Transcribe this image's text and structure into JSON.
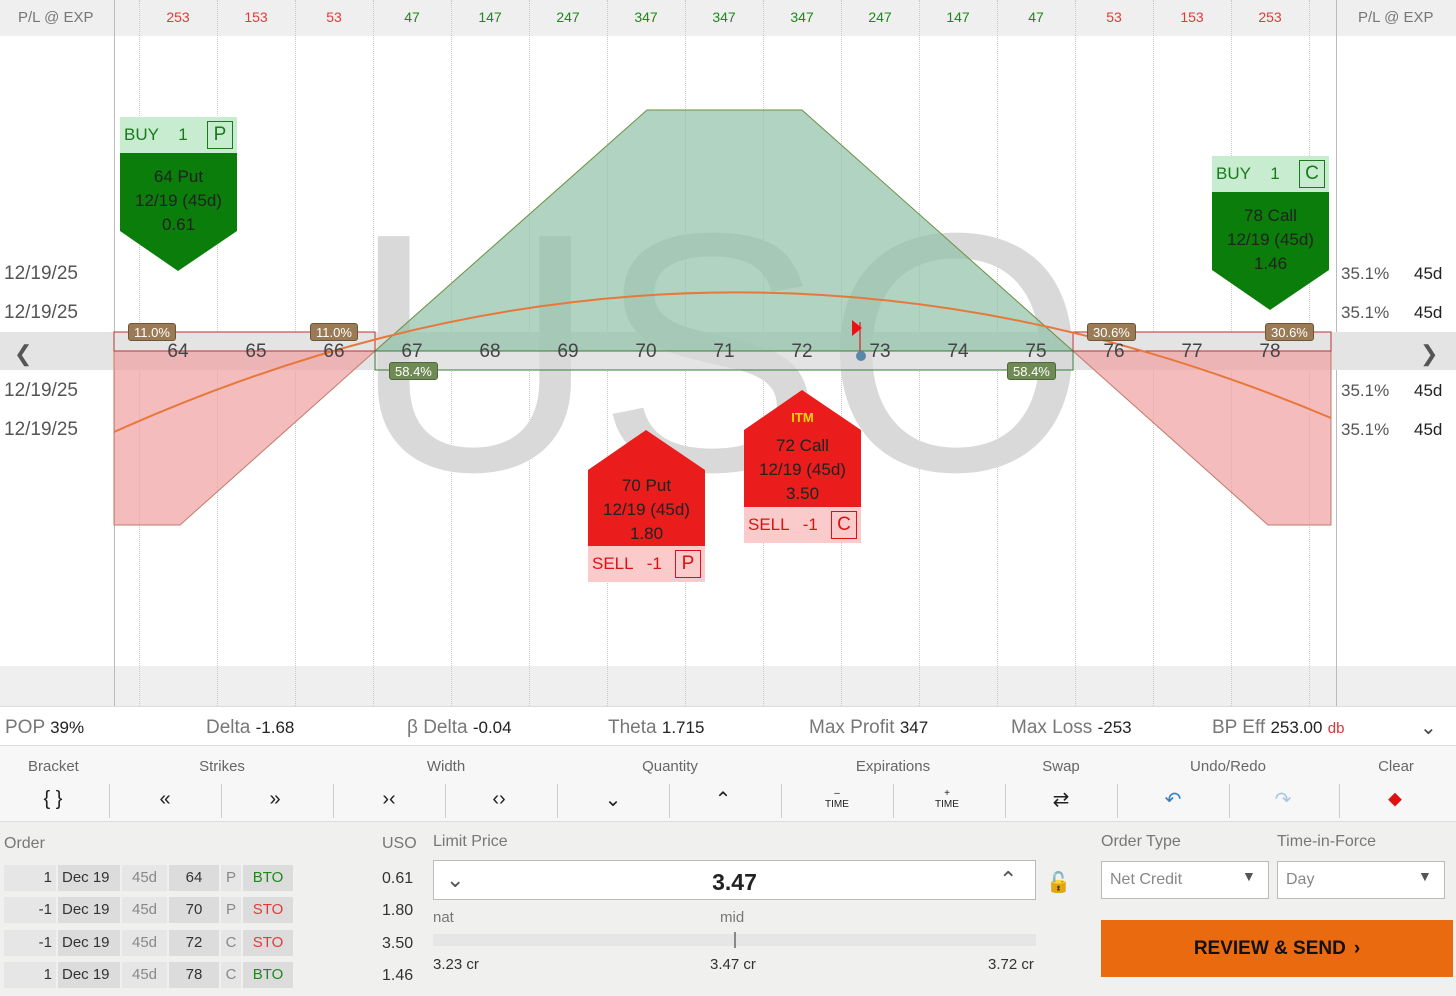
{
  "header": {
    "left_label": "P/L @ EXP",
    "right_label": "P/L @ EXP",
    "pl_values": [
      "253",
      "153",
      "53",
      "47",
      "147",
      "247",
      "347",
      "347",
      "347",
      "247",
      "147",
      "47",
      "53",
      "153",
      "253"
    ]
  },
  "watermark": "USO",
  "dates": {
    "rows": [
      "12/19/25",
      "12/19/25",
      "12/19/25",
      "12/19/25"
    ],
    "iv": [
      "35.1%",
      "35.1%",
      "35.1%",
      "35.1%"
    ],
    "dte": [
      "45d",
      "45d",
      "45d",
      "45d"
    ]
  },
  "strikes": [
    "64",
    "65",
    "66",
    "67",
    "68",
    "69",
    "70",
    "71",
    "72",
    "73",
    "74",
    "75",
    "76",
    "77",
    "78"
  ],
  "probabilities": {
    "left_outer": "11.0%",
    "left_inner": "11.0%",
    "right_inner": "30.6%",
    "right_outer": "30.6%",
    "profit_left": "58.4%",
    "profit_right": "58.4%"
  },
  "legs": {
    "put_long": {
      "action": "BUY",
      "qty": "1",
      "type_letter": "P",
      "name": "64 Put",
      "exp": "12/19 (45d)",
      "price": "0.61"
    },
    "call_long": {
      "action": "BUY",
      "qty": "1",
      "type_letter": "C",
      "name": "78 Call",
      "exp": "12/19 (45d)",
      "price": "1.46"
    },
    "put_short": {
      "action": "SELL",
      "qty": "-1",
      "type_letter": "P",
      "name": "70 Put",
      "exp": "12/19 (45d)",
      "price": "1.80"
    },
    "call_short": {
      "action": "SELL",
      "qty": "-1",
      "type_letter": "C",
      "name": "72 Call",
      "exp": "12/19 (45d)",
      "price": "3.50",
      "badge": "ITM"
    }
  },
  "stats": {
    "pop_label": "POP",
    "pop": "39%",
    "delta_label": "Delta",
    "delta": "-1.68",
    "bdelta_label": "β Delta",
    "bdelta": "-0.04",
    "theta_label": "Theta",
    "theta": "1.715",
    "maxprofit_label": "Max Profit",
    "maxprofit": "347",
    "maxloss_label": "Max Loss",
    "maxloss": "-253",
    "bpeff_label": "BP Eff",
    "bpeff": "253.00",
    "bpeff_suffix": "db"
  },
  "toolbar": {
    "bracket": "Bracket",
    "strikes": "Strikes",
    "width": "Width",
    "quantity": "Quantity",
    "expirations": "Expirations",
    "swap": "Swap",
    "undoredo": "Undo/Redo",
    "clear": "Clear",
    "time_label": "TIME"
  },
  "order": {
    "order_label": "Order",
    "symbol": "USO",
    "rows": [
      {
        "qty": "1",
        "exp": "Dec 19",
        "dte": "45d",
        "strike": "64",
        "type": "P",
        "action": "BTO",
        "price": "0.61"
      },
      {
        "qty": "-1",
        "exp": "Dec 19",
        "dte": "45d",
        "strike": "70",
        "type": "P",
        "action": "STO",
        "price": "1.80"
      },
      {
        "qty": "-1",
        "exp": "Dec 19",
        "dte": "45d",
        "strike": "72",
        "type": "C",
        "action": "STO",
        "price": "3.50"
      },
      {
        "qty": "1",
        "exp": "Dec 19",
        "dte": "45d",
        "strike": "78",
        "type": "C",
        "action": "BTO",
        "price": "1.46"
      }
    ],
    "limit_label": "Limit Price",
    "limit_value": "3.47",
    "nat_label": "nat",
    "mid_label": "mid",
    "nat_value": "3.23 cr",
    "mid_value": "3.47 cr",
    "far_value": "3.72 cr",
    "order_type_label": "Order Type",
    "order_type": "Net Credit",
    "tif_label": "Time-in-Force",
    "tif": "Day",
    "review_label": "REVIEW & SEND"
  }
}
